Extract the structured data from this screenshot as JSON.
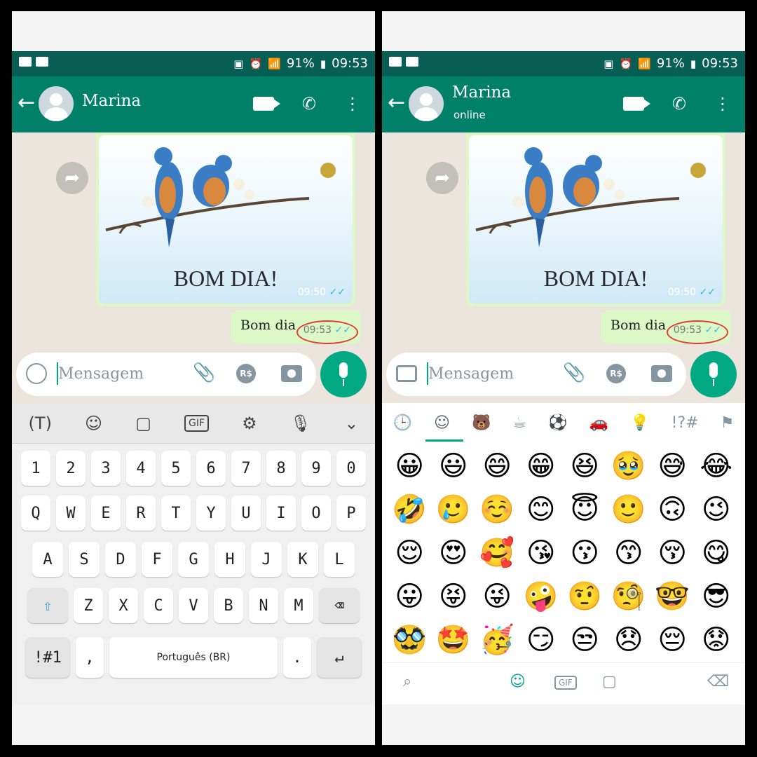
{
  "status": {
    "battery": "91%",
    "time": "09:53"
  },
  "contact": {
    "name": "Marina",
    "status": "online"
  },
  "messages": {
    "image_caption": "BOM DIA!",
    "image_time": "09:50",
    "text": "Bom dia",
    "text_time": "09:53",
    "ticks": "✓✓"
  },
  "input": {
    "placeholder": "Mensagem",
    "payment": "R$"
  },
  "keyboard": {
    "toolbar": [
      "(T)",
      "☺",
      "sticker",
      "GIF",
      "⚙",
      "mic",
      "⌄"
    ],
    "row_num": [
      "1",
      "2",
      "3",
      "4",
      "5",
      "6",
      "7",
      "8",
      "9",
      "0"
    ],
    "row1": [
      "Q",
      "W",
      "E",
      "R",
      "T",
      "Y",
      "U",
      "I",
      "O",
      "P"
    ],
    "row2": [
      "A",
      "S",
      "D",
      "F",
      "G",
      "H",
      "J",
      "K",
      "L"
    ],
    "row3": [
      "Z",
      "X",
      "C",
      "V",
      "B",
      "N",
      "M"
    ],
    "sym": "!#1",
    "comma": ",",
    "space": "Português (BR)",
    "period": "."
  },
  "emoji_keyboard": {
    "categories": [
      "🕒",
      "☺",
      "🐻",
      "☕",
      "⚽",
      "🚗",
      "💡",
      "!?#",
      "⚑"
    ],
    "emojis": [
      "😀",
      "😃",
      "😄",
      "😁",
      "😆",
      "🥹",
      "😅",
      "😂",
      "🤣",
      "🥲",
      "☺️",
      "😊",
      "😇",
      "🙂",
      "🙃",
      "😉",
      "😌",
      "😍",
      "🥰",
      "😘",
      "😗",
      "😙",
      "😚",
      "😋",
      "😛",
      "😝",
      "😜",
      "🤪",
      "🤨",
      "🧐",
      "🤓",
      "😎",
      "🥸",
      "🤩",
      "🥳",
      "😏",
      "😒",
      "😞",
      "😔",
      "😟"
    ],
    "gif": "GIF"
  }
}
